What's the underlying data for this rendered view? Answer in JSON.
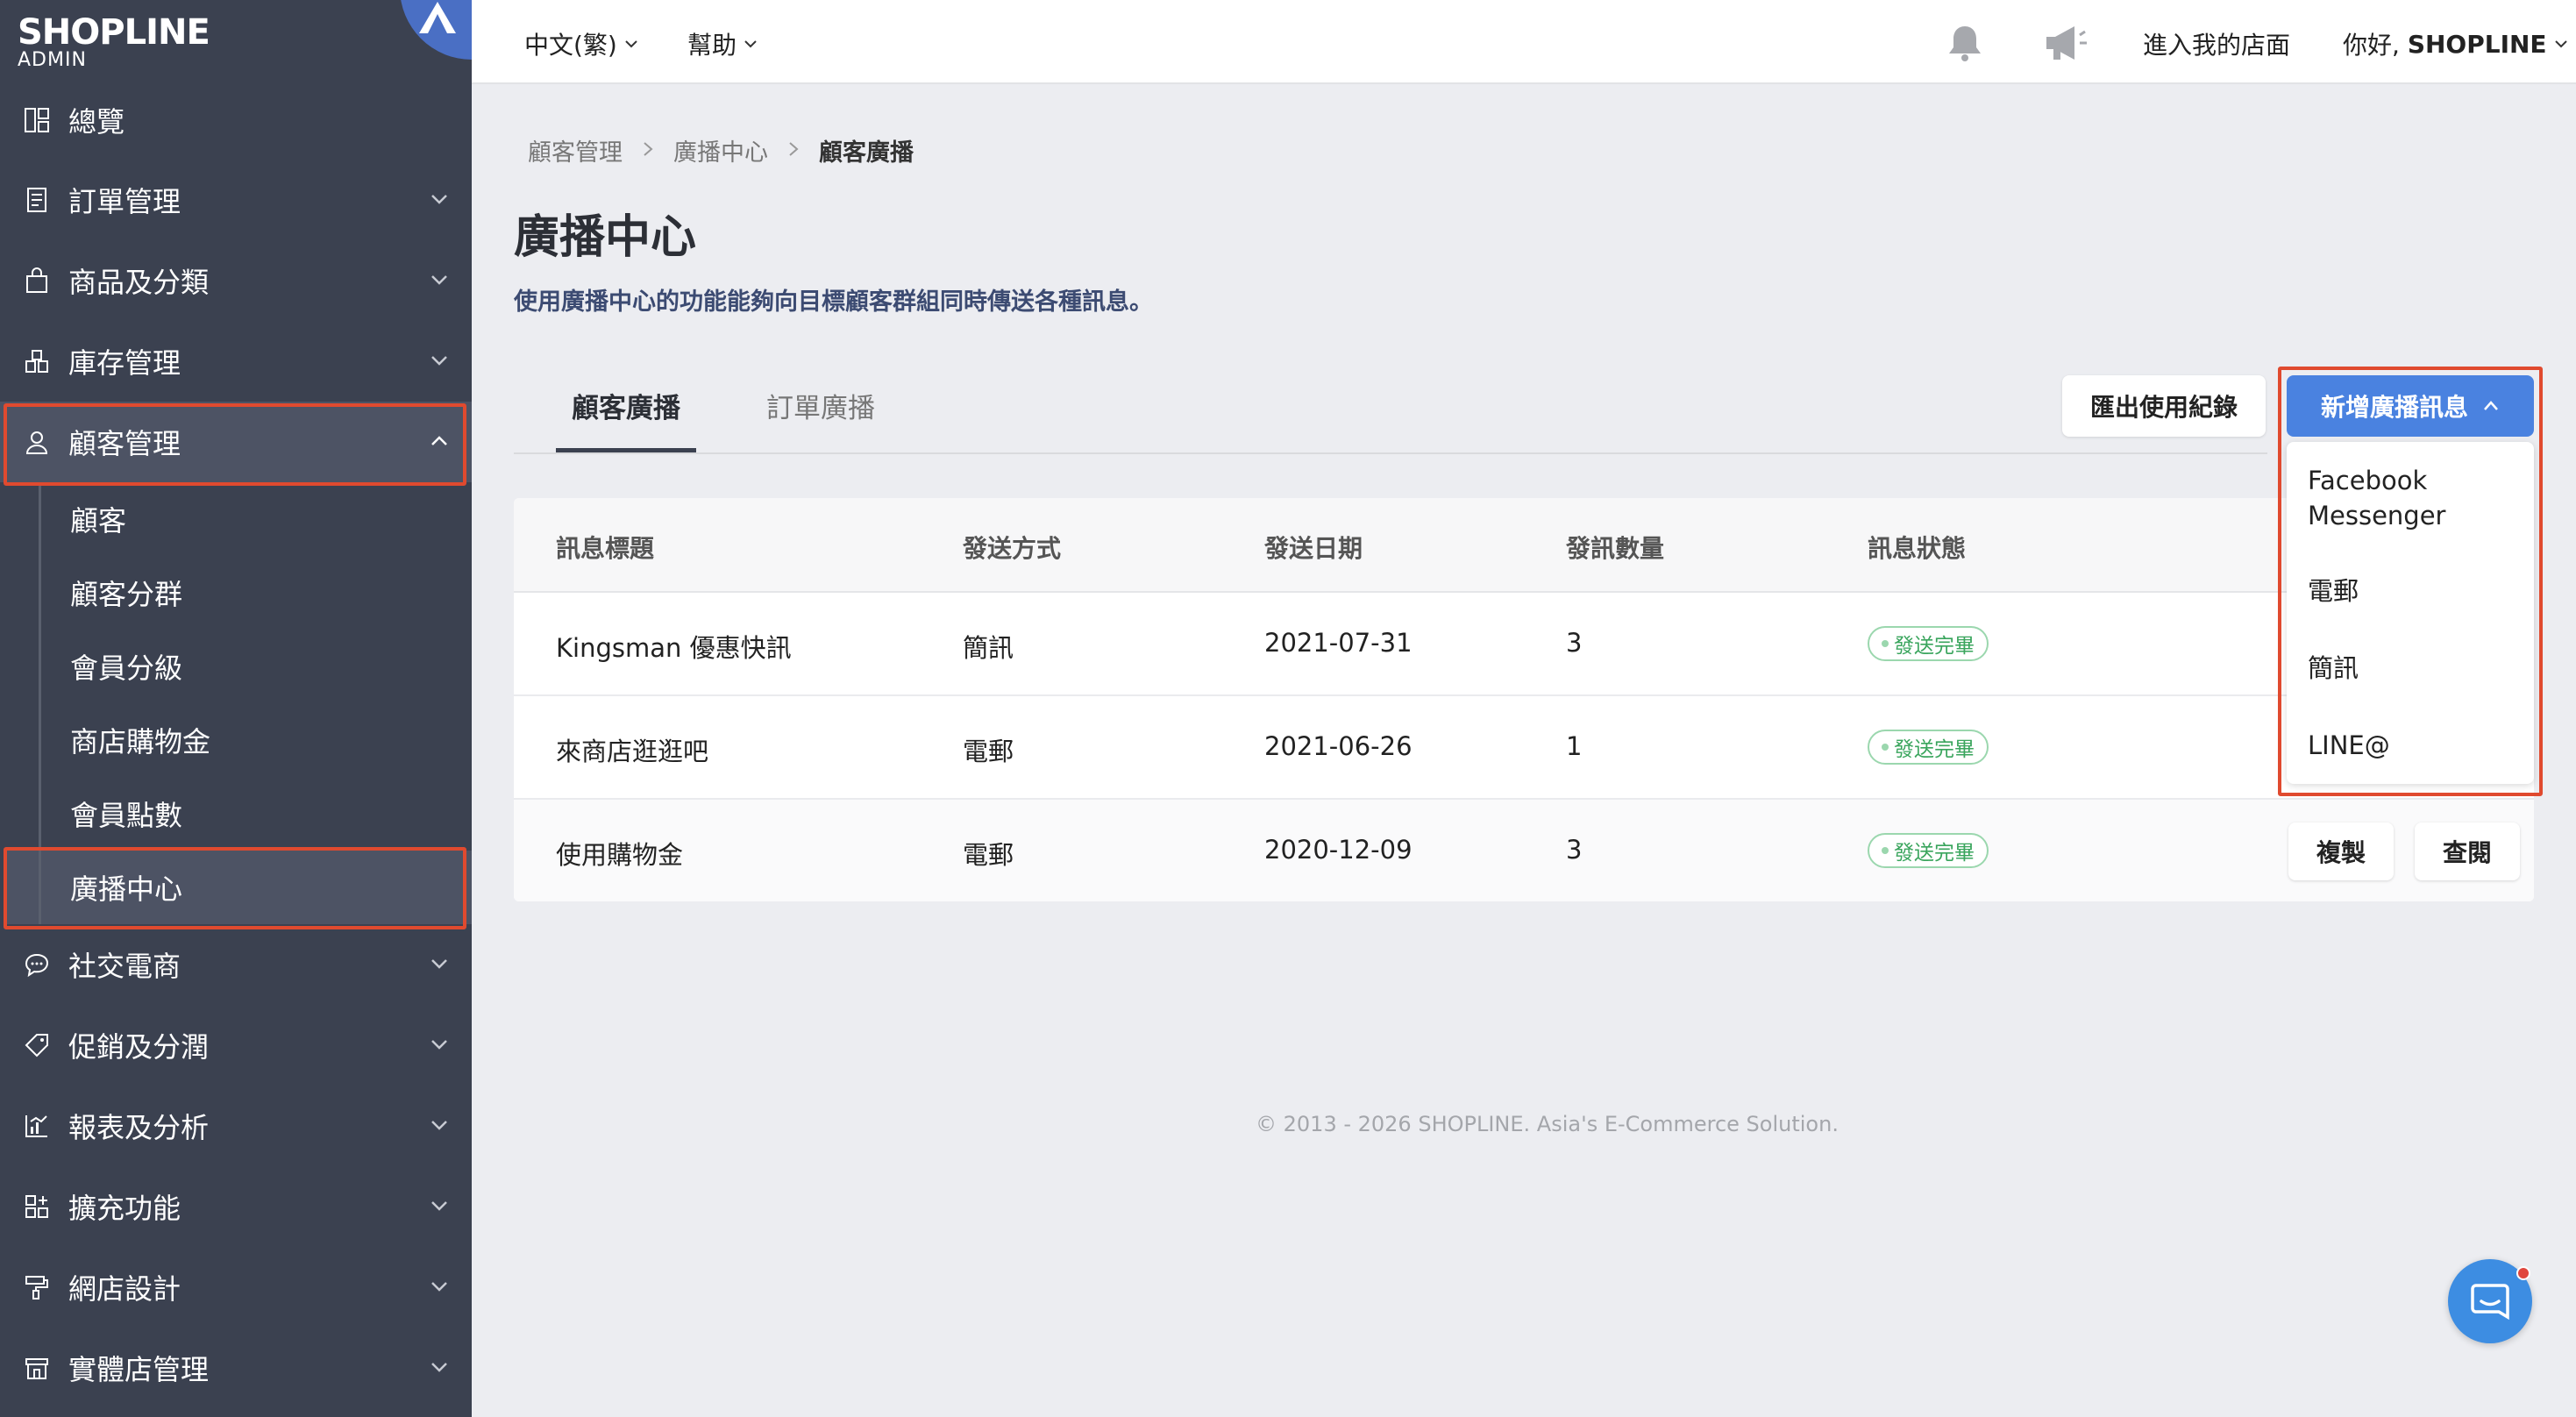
{
  "brand": {
    "name": "SHOPLINE",
    "sub": "ADMIN"
  },
  "sidebar": {
    "items": [
      {
        "label": "總覽",
        "icon": "dashboard-icon",
        "expandable": false
      },
      {
        "label": "訂單管理",
        "icon": "order-icon",
        "expandable": true
      },
      {
        "label": "商品及分類",
        "icon": "bag-icon",
        "expandable": true
      },
      {
        "label": "庫存管理",
        "icon": "inventory-icon",
        "expandable": true
      },
      {
        "label": "顧客管理",
        "icon": "user-icon",
        "expandable": true,
        "expanded": true
      },
      {
        "label": "社交電商",
        "icon": "chat-bubble-icon",
        "expandable": true
      },
      {
        "label": "促銷及分潤",
        "icon": "tag-icon",
        "expandable": true
      },
      {
        "label": "報表及分析",
        "icon": "chart-icon",
        "expandable": true
      },
      {
        "label": "擴充功能",
        "icon": "apps-icon",
        "expandable": true
      },
      {
        "label": "網店設計",
        "icon": "paint-roller-icon",
        "expandable": true
      },
      {
        "label": "實體店管理",
        "icon": "store-icon",
        "expandable": true
      }
    ],
    "customer_sub": [
      "顧客",
      "顧客分群",
      "會員分級",
      "商店購物金",
      "會員點數",
      "廣播中心"
    ]
  },
  "topbar": {
    "language": "中文(繁)",
    "help": "幫助",
    "store_link": "進入我的店面",
    "greeting_prefix": "你好,",
    "greeting_name": "SHOPLINE"
  },
  "breadcrumb": [
    "顧客管理",
    "廣播中心",
    "顧客廣播"
  ],
  "page": {
    "title": "廣播中心",
    "description": "使用廣播中心的功能能夠向目標顧客群組同時傳送各種訊息。"
  },
  "tabs": [
    "顧客廣播",
    "訂單廣播"
  ],
  "actions": {
    "export": "匯出使用紀錄",
    "new_broadcast": "新增廣播訊息",
    "dropdown": [
      "Facebook\nMessenger",
      "電郵",
      "簡訊",
      "LINE@"
    ]
  },
  "table": {
    "headers": [
      "訊息標題",
      "發送方式",
      "發送日期",
      "發訊數量",
      "訊息狀態"
    ],
    "rows": [
      {
        "title": "Kingsman 優惠快訊",
        "method": "簡訊",
        "date": "2021-07-31",
        "count": "3",
        "status": "發送完畢"
      },
      {
        "title": "來商店逛逛吧",
        "method": "電郵",
        "date": "2021-06-26",
        "count": "1",
        "status": "發送完畢"
      },
      {
        "title": "使用購物金",
        "method": "電郵",
        "date": "2020-12-09",
        "count": "3",
        "status": "發送完畢"
      }
    ],
    "row_actions": [
      "複製",
      "查閱"
    ]
  },
  "footer": "© 2013 - 2026 SHOPLINE. Asia's E-Commerce Solution.",
  "colors": {
    "sidebar": "#3b4150",
    "primary": "#4a82e0",
    "highlight": "#e04a2f",
    "success": "#3aa55d"
  }
}
